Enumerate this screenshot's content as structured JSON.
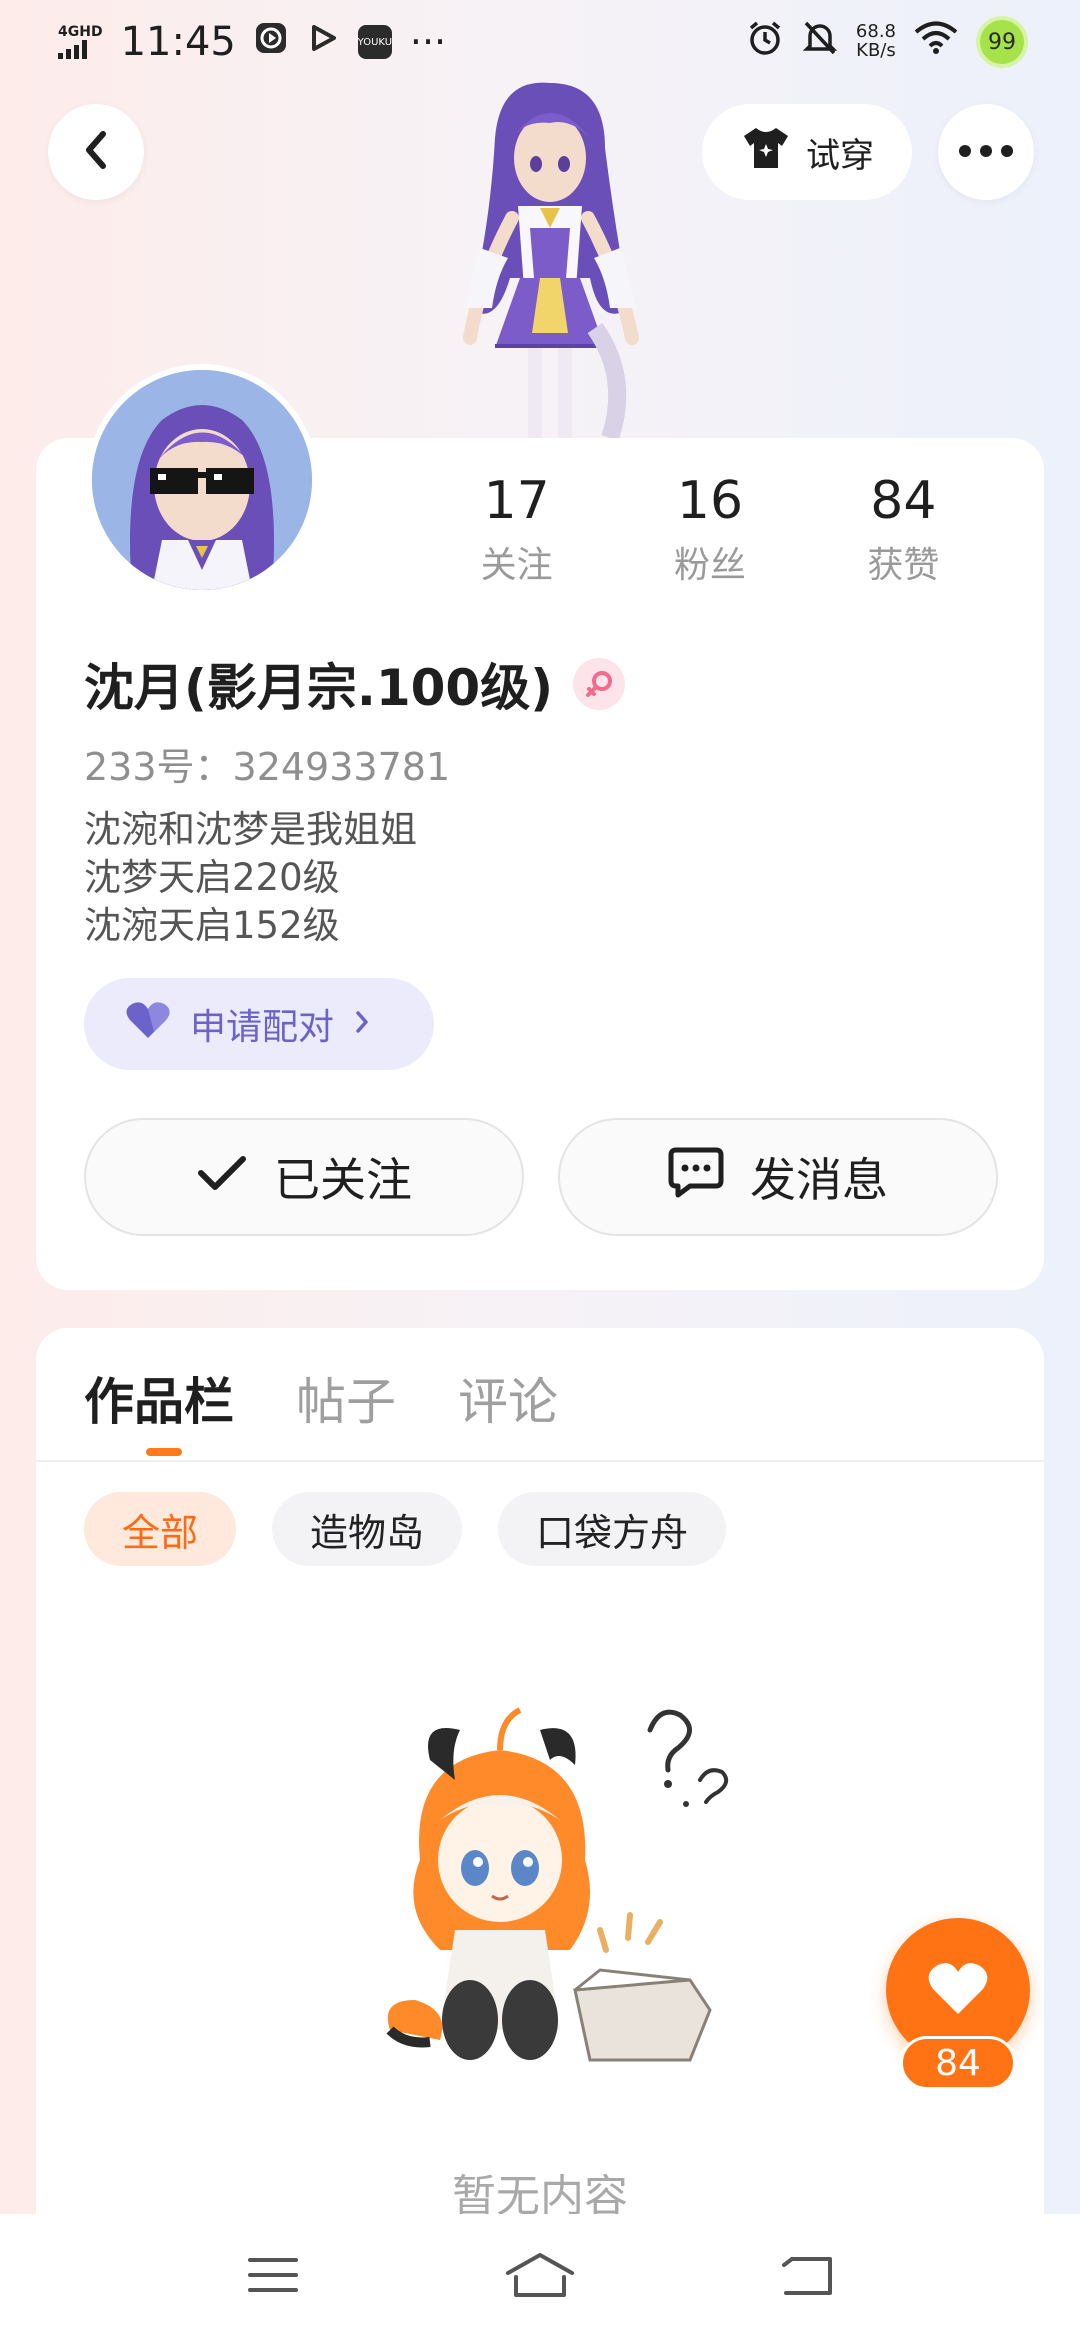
{
  "status_bar": {
    "network": "4GHD",
    "time": "11:45",
    "app_icon_label": "YOUKU",
    "overflow": "···",
    "speed_value": "68.8",
    "speed_unit": "KB/s",
    "battery": "99",
    "icons": [
      "play-circle-icon",
      "play-icon",
      "youku-icon",
      "alarm-icon",
      "mute-icon",
      "wifi-icon",
      "battery-icon"
    ]
  },
  "header": {
    "back_icon": "chevron-left-icon",
    "try_on_label": "试穿",
    "try_on_icon": "tshirt-icon",
    "more_icon": "more-dots-icon"
  },
  "profile": {
    "stats": [
      {
        "value": "17",
        "label": "关注"
      },
      {
        "value": "16",
        "label": "粉丝"
      },
      {
        "value": "84",
        "label": "获赞"
      }
    ],
    "nickname": "沈月(影月宗.100级)",
    "gender_icon": "female-icon",
    "uid": "233号：324933781",
    "bio": [
      "沈涴和沈梦是我姐姐",
      "沈梦天启220级",
      "沈涴天启152级"
    ],
    "pair_label": "申请配对",
    "follow_label": "已关注",
    "message_label": "发消息"
  },
  "content": {
    "tabs": [
      {
        "label": "作品栏",
        "active": true
      },
      {
        "label": "帖子",
        "active": false
      },
      {
        "label": "评论",
        "active": false
      }
    ],
    "chips": [
      {
        "label": "全部",
        "active": true
      },
      {
        "label": "造物岛",
        "active": false
      },
      {
        "label": "口袋方舟",
        "active": false
      }
    ],
    "empty_text": "暂无内容",
    "like_count": "84"
  },
  "nav_bar": {
    "icons": [
      "menu-icon",
      "home-icon",
      "back-icon"
    ]
  },
  "colors": {
    "accent_orange": "#ff7314",
    "pair_purple": "#6b63c9",
    "gender_pink": "#f06b8e"
  }
}
